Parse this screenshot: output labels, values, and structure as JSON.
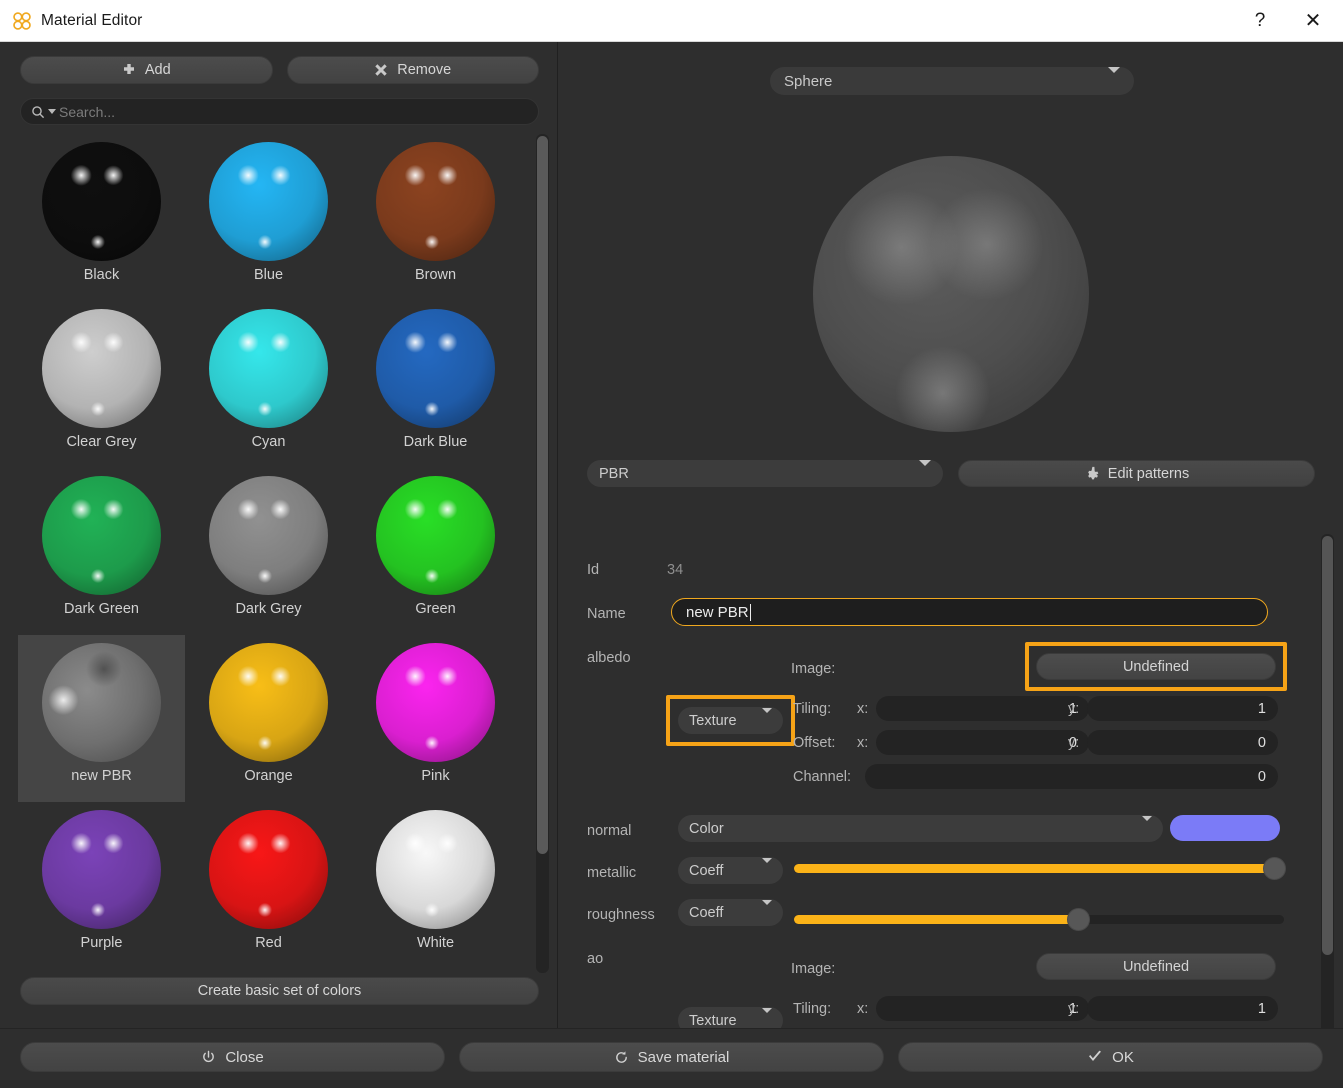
{
  "window": {
    "title": "Material Editor",
    "logo_icon": "material-editor-logo-icon",
    "help_label": "?",
    "close_label": "✕"
  },
  "library": {
    "add_label": "Add",
    "add_icon": "plus-icon",
    "remove_label": "Remove",
    "remove_icon": "cross-icon",
    "search": {
      "icon": "search-icon",
      "placeholder": "Search...",
      "value": ""
    },
    "create_basic_label": "Create basic set of colors",
    "materials": [
      {
        "name": "Black",
        "color": "#0d0d0d",
        "selected": false
      },
      {
        "name": "Blue",
        "color": "#1f9ed4",
        "selected": false
      },
      {
        "name": "Brown",
        "color": "#7a3a1c",
        "selected": false
      },
      {
        "name": "Clear Grey",
        "color": "#b3b3b3",
        "selected": false
      },
      {
        "name": "Cyan",
        "color": "#2ec9cc",
        "selected": false
      },
      {
        "name": "Dark Blue",
        "color": "#1f5ba8",
        "selected": false
      },
      {
        "name": "Dark Green",
        "color": "#1d9b4b",
        "selected": false
      },
      {
        "name": "Dark Grey",
        "color": "#7e7e7e",
        "selected": false
      },
      {
        "name": "Green",
        "color": "#24c221",
        "selected": false
      },
      {
        "name": "new PBR",
        "color": "#6f6f6f",
        "selected": true
      },
      {
        "name": "Orange",
        "color": "#d8a514",
        "selected": false
      },
      {
        "name": "Pink",
        "color": "#da1fd0",
        "selected": false
      },
      {
        "name": "Purple",
        "color": "#6b3aa0",
        "selected": false
      },
      {
        "name": "Red",
        "color": "#d81414",
        "selected": false
      },
      {
        "name": "White",
        "color": "#d8d8d8",
        "selected": false
      }
    ]
  },
  "preview": {
    "shape_value": "Sphere",
    "shape_icon": "chevron-down-icon"
  },
  "shader": {
    "type_value": "PBR",
    "type_icon": "chevron-down-icon",
    "edit_patterns_label": "Edit patterns",
    "edit_patterns_icon": "gear-icon"
  },
  "properties": {
    "id_label": "Id",
    "id_value": "34",
    "name_label": "Name",
    "name_value": "new PBR",
    "albedo": {
      "label": "albedo",
      "mode": "Texture",
      "mode_icon": "chevron-down-icon",
      "image_label": "Image:",
      "image_value": "Undefined",
      "tiling_label": "Tiling:",
      "tiling_x_label": "x:",
      "tiling_x": "1",
      "tiling_y_label": "y:",
      "tiling_y": "1",
      "offset_label": "Offset:",
      "offset_x_label": "x:",
      "offset_x": "0",
      "offset_y_label": "y:",
      "offset_y": "0",
      "channel_label": "Channel:",
      "channel": "0"
    },
    "normal": {
      "label": "normal",
      "mode": "Color",
      "mode_icon": "chevron-down-icon",
      "color": "#7b7bf7"
    },
    "metallic": {
      "label": "metallic",
      "mode": "Coeff",
      "mode_icon": "chevron-down-icon",
      "percent": 98
    },
    "roughness": {
      "label": "roughness",
      "mode": "Coeff",
      "mode_icon": "chevron-down-icon",
      "percent": 58
    },
    "ao": {
      "label": "ao",
      "mode": "Texture",
      "mode_icon": "chevron-down-icon",
      "image_label": "Image:",
      "image_value": "Undefined",
      "tiling_label": "Tiling:",
      "tiling_x_label": "x:",
      "tiling_x": "1",
      "tiling_y_label": "y:",
      "tiling_y": "1"
    }
  },
  "highlight_color": "#f6a317",
  "footer": {
    "close_label": "Close",
    "close_icon": "power-icon",
    "save_label": "Save material",
    "save_icon": "refresh-icon",
    "ok_label": "OK",
    "ok_icon": "check-icon"
  }
}
